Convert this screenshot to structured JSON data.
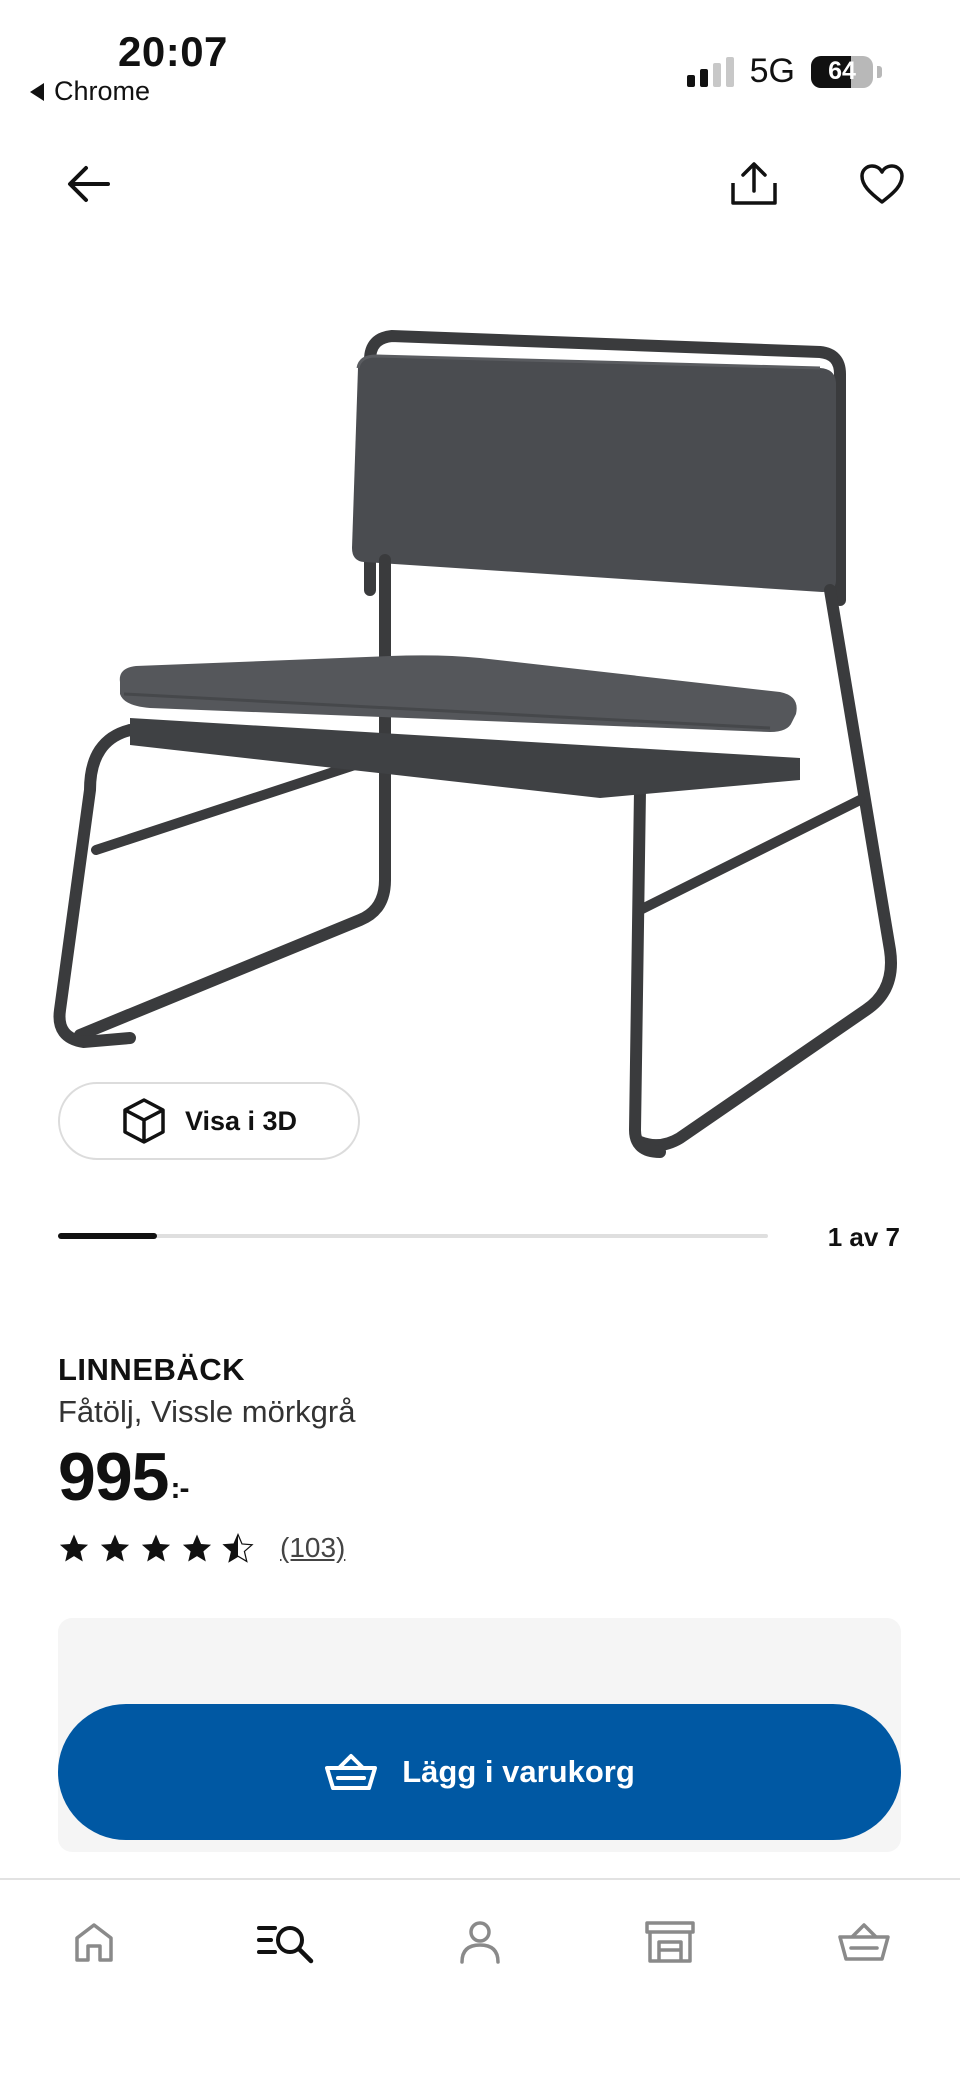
{
  "status_bar": {
    "time": "20:07",
    "back_app": "Chrome",
    "network": "5G",
    "battery_percent": "64",
    "battery_level": 0.64
  },
  "top_nav": {
    "back_icon": "arrow-left-icon",
    "share_icon": "share-icon",
    "favorite_icon": "heart-icon"
  },
  "gallery": {
    "view_3d_label": "Visa i 3D",
    "view_3d_icon": "cube-icon",
    "position_label": "1 av 7",
    "progress_fraction": 0.14
  },
  "product": {
    "name": "LINNEBÄCK",
    "description": "Fåtölj, Vissle mörkgrå",
    "price": "995",
    "price_suffix": ":-",
    "rating": 4.5,
    "rating_max": 5,
    "review_count": "(103)"
  },
  "cart": {
    "add_label": "Lägg i varukorg",
    "add_icon": "basket-icon"
  },
  "bottom_nav": {
    "items": [
      "home-icon",
      "search-menu-icon",
      "profile-icon",
      "store-icon",
      "basket-icon"
    ],
    "active": "search-menu-icon"
  },
  "colors": {
    "primary_blue": "#0058a3",
    "panel_gray": "#f5f5f5",
    "text": "#111111",
    "inactive_icon": "#8a8a8a"
  }
}
